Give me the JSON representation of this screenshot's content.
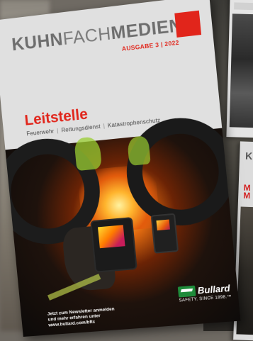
{
  "cover": {
    "masthead_bold_1": "KUHN",
    "masthead_light": "FACH",
    "masthead_bold_2": "MEDIEN",
    "issue": "AUSGABE 3 | 2022",
    "headline": "Leitstelle",
    "subline_items": [
      "Feuerwehr",
      "Rettungsdienst",
      "Katastrophenschutz"
    ],
    "newsletter_lines": [
      "Jetzt zum Newsletter anmelden",
      "und mehr erfahren unter",
      "www.bullard.com/bftc"
    ],
    "brand_name": "Bullard",
    "brand_tagline": "SAFETY. SINCE 1898.™",
    "accent_color": "#e1251b"
  },
  "second_cover": {
    "logo_fragment": "KU",
    "title_fragment": "M\nM"
  },
  "icons": [
    "bullard-logo-icon"
  ]
}
